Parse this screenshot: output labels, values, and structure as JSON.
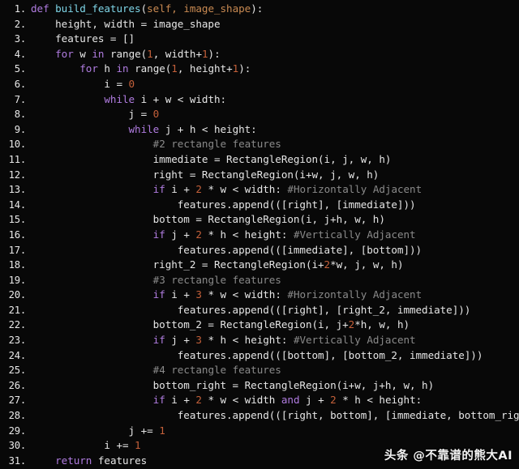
{
  "editor": {
    "language": "python",
    "theme_background": "#080808",
    "line_number_color": "#e8e8e8",
    "colors": {
      "keyword": "#b07ce0",
      "function": "#7fd6e8",
      "argument": "#c98a52",
      "number": "#c4603a",
      "comment": "#8a8a8a",
      "plain": "#e6e6e6"
    }
  },
  "watermark": {
    "text": "头条 @不靠谱的熊大AI"
  },
  "code": {
    "lines": [
      {
        "n": "1.",
        "tokens": [
          {
            "t": "def ",
            "c": "kw"
          },
          {
            "t": "build_features",
            "c": "fn"
          },
          {
            "t": "(",
            "c": "pl"
          },
          {
            "t": "self, image_shape",
            "c": "arg"
          },
          {
            "t": "):",
            "c": "pl"
          }
        ]
      },
      {
        "n": "2.",
        "tokens": [
          {
            "t": "    height, width = image_shape",
            "c": "pl"
          }
        ]
      },
      {
        "n": "3.",
        "tokens": [
          {
            "t": "    features = []",
            "c": "pl"
          }
        ]
      },
      {
        "n": "4.",
        "tokens": [
          {
            "t": "    ",
            "c": "pl"
          },
          {
            "t": "for",
            "c": "kw"
          },
          {
            "t": " w ",
            "c": "pl"
          },
          {
            "t": "in",
            "c": "kw"
          },
          {
            "t": " range(",
            "c": "pl"
          },
          {
            "t": "1",
            "c": "num"
          },
          {
            "t": ", width+",
            "c": "pl"
          },
          {
            "t": "1",
            "c": "num"
          },
          {
            "t": "):",
            "c": "pl"
          }
        ]
      },
      {
        "n": "5.",
        "tokens": [
          {
            "t": "        ",
            "c": "pl"
          },
          {
            "t": "for",
            "c": "kw"
          },
          {
            "t": " h ",
            "c": "pl"
          },
          {
            "t": "in",
            "c": "kw"
          },
          {
            "t": " range(",
            "c": "pl"
          },
          {
            "t": "1",
            "c": "num"
          },
          {
            "t": ", height+",
            "c": "pl"
          },
          {
            "t": "1",
            "c": "num"
          },
          {
            "t": "):",
            "c": "pl"
          }
        ]
      },
      {
        "n": "6.",
        "tokens": [
          {
            "t": "            i = ",
            "c": "pl"
          },
          {
            "t": "0",
            "c": "num"
          }
        ]
      },
      {
        "n": "7.",
        "tokens": [
          {
            "t": "            ",
            "c": "pl"
          },
          {
            "t": "while",
            "c": "kw"
          },
          {
            "t": " i + w < width:",
            "c": "pl"
          }
        ]
      },
      {
        "n": "8.",
        "tokens": [
          {
            "t": "                j = ",
            "c": "pl"
          },
          {
            "t": "0",
            "c": "num"
          }
        ]
      },
      {
        "n": "9.",
        "tokens": [
          {
            "t": "                ",
            "c": "pl"
          },
          {
            "t": "while",
            "c": "kw"
          },
          {
            "t": " j + h < height:",
            "c": "pl"
          }
        ]
      },
      {
        "n": "10.",
        "tokens": [
          {
            "t": "                    ",
            "c": "pl"
          },
          {
            "t": "#2 rectangle features",
            "c": "cmt"
          }
        ]
      },
      {
        "n": "11.",
        "tokens": [
          {
            "t": "                    immediate = RectangleRegion(i, j, w, h)",
            "c": "pl"
          }
        ]
      },
      {
        "n": "12.",
        "tokens": [
          {
            "t": "                    right = RectangleRegion(i+w, j, w, h)",
            "c": "pl"
          }
        ]
      },
      {
        "n": "13.",
        "tokens": [
          {
            "t": "                    ",
            "c": "pl"
          },
          {
            "t": "if",
            "c": "kw"
          },
          {
            "t": " i + ",
            "c": "pl"
          },
          {
            "t": "2",
            "c": "num"
          },
          {
            "t": " * w < width: ",
            "c": "pl"
          },
          {
            "t": "#Horizontally Adjacent",
            "c": "cmt"
          }
        ]
      },
      {
        "n": "14.",
        "tokens": [
          {
            "t": "                        features.append(([right], [immediate]))",
            "c": "pl"
          }
        ]
      },
      {
        "n": "15.",
        "tokens": [
          {
            "t": "                    bottom = RectangleRegion(i, j+h, w, h)",
            "c": "pl"
          }
        ]
      },
      {
        "n": "16.",
        "tokens": [
          {
            "t": "                    ",
            "c": "pl"
          },
          {
            "t": "if",
            "c": "kw"
          },
          {
            "t": " j + ",
            "c": "pl"
          },
          {
            "t": "2",
            "c": "num"
          },
          {
            "t": " * h < height: ",
            "c": "pl"
          },
          {
            "t": "#Vertically Adjacent",
            "c": "cmt"
          }
        ]
      },
      {
        "n": "17.",
        "tokens": [
          {
            "t": "                        features.append(([immediate], [bottom]))",
            "c": "pl"
          }
        ]
      },
      {
        "n": "18.",
        "tokens": [
          {
            "t": "                    right_2 = RectangleRegion(i+",
            "c": "pl"
          },
          {
            "t": "2",
            "c": "num"
          },
          {
            "t": "*w, j, w, h)",
            "c": "pl"
          }
        ]
      },
      {
        "n": "19.",
        "tokens": [
          {
            "t": "                    ",
            "c": "pl"
          },
          {
            "t": "#3 rectangle features",
            "c": "cmt"
          }
        ]
      },
      {
        "n": "20.",
        "tokens": [
          {
            "t": "                    ",
            "c": "pl"
          },
          {
            "t": "if",
            "c": "kw"
          },
          {
            "t": " i + ",
            "c": "pl"
          },
          {
            "t": "3",
            "c": "num"
          },
          {
            "t": " * w < width: ",
            "c": "pl"
          },
          {
            "t": "#Horizontally Adjacent",
            "c": "cmt"
          }
        ]
      },
      {
        "n": "21.",
        "tokens": [
          {
            "t": "                        features.append(([right], [right_2, immediate]))",
            "c": "pl"
          }
        ]
      },
      {
        "n": "22.",
        "tokens": [
          {
            "t": "                    bottom_2 = RectangleRegion(i, j+",
            "c": "pl"
          },
          {
            "t": "2",
            "c": "num"
          },
          {
            "t": "*h, w, h)",
            "c": "pl"
          }
        ]
      },
      {
        "n": "23.",
        "tokens": [
          {
            "t": "                    ",
            "c": "pl"
          },
          {
            "t": "if",
            "c": "kw"
          },
          {
            "t": " j + ",
            "c": "pl"
          },
          {
            "t": "3",
            "c": "num"
          },
          {
            "t": " * h < height: ",
            "c": "pl"
          },
          {
            "t": "#Vertically Adjacent",
            "c": "cmt"
          }
        ]
      },
      {
        "n": "24.",
        "tokens": [
          {
            "t": "                        features.append(([bottom], [bottom_2, immediate]))",
            "c": "pl"
          }
        ]
      },
      {
        "n": "25.",
        "tokens": [
          {
            "t": "                    ",
            "c": "pl"
          },
          {
            "t": "#4 rectangle features",
            "c": "cmt"
          }
        ]
      },
      {
        "n": "26.",
        "tokens": [
          {
            "t": "                    bottom_right = RectangleRegion(i+w, j+h, w, h)",
            "c": "pl"
          }
        ]
      },
      {
        "n": "27.",
        "tokens": [
          {
            "t": "                    ",
            "c": "pl"
          },
          {
            "t": "if",
            "c": "kw"
          },
          {
            "t": " i + ",
            "c": "pl"
          },
          {
            "t": "2",
            "c": "num"
          },
          {
            "t": " * w < width ",
            "c": "pl"
          },
          {
            "t": "and",
            "c": "kw"
          },
          {
            "t": " j + ",
            "c": "pl"
          },
          {
            "t": "2",
            "c": "num"
          },
          {
            "t": " * h < height:",
            "c": "pl"
          }
        ]
      },
      {
        "n": "28.",
        "tokens": [
          {
            "t": "                        features.append(([right, bottom], [immediate, bottom_right]))",
            "c": "pl"
          }
        ]
      },
      {
        "n": "29.",
        "tokens": [
          {
            "t": "                j += ",
            "c": "pl"
          },
          {
            "t": "1",
            "c": "num"
          }
        ]
      },
      {
        "n": "30.",
        "tokens": [
          {
            "t": "            i += ",
            "c": "pl"
          },
          {
            "t": "1",
            "c": "num"
          }
        ]
      },
      {
        "n": "31.",
        "tokens": [
          {
            "t": "    ",
            "c": "pl"
          },
          {
            "t": "return",
            "c": "kw"
          },
          {
            "t": " features",
            "c": "pl"
          }
        ]
      }
    ]
  }
}
